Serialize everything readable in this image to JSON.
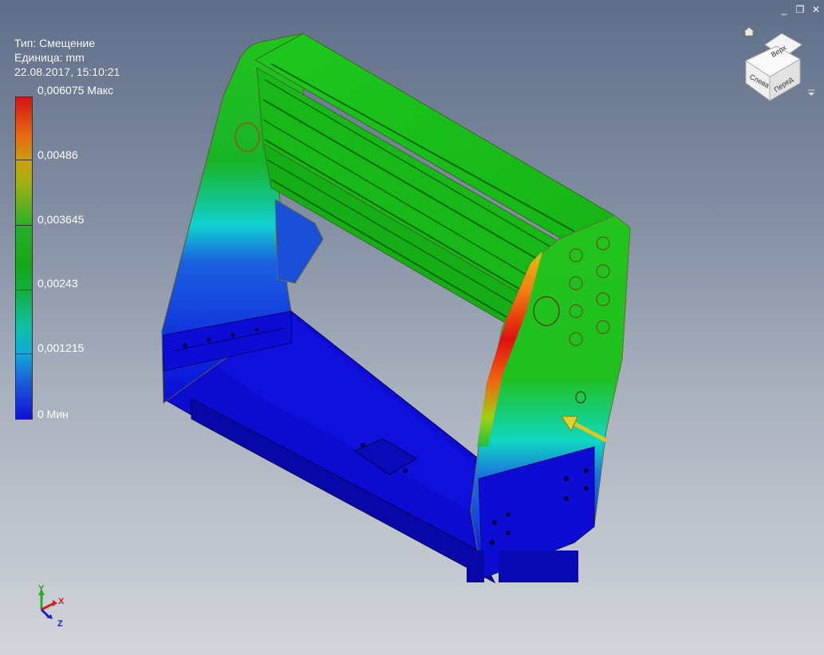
{
  "info": {
    "type_line": "Тип: Смещение",
    "unit_line": "Единица: mm",
    "date_line": "22.08.2017, 15:10:21"
  },
  "legend": {
    "labels": [
      "0,006075 Макс",
      "0,00486",
      "0,003645",
      "0,00243",
      "0,001215",
      "0 Мин"
    ]
  },
  "viewcube": {
    "top_label": "Верх",
    "left_label": "Слева",
    "front_label": "Перед"
  },
  "axes": {
    "x": "X",
    "y": "Y",
    "z": "Z"
  },
  "window_controls": {
    "minimize": "_",
    "restore": "❐",
    "close": "✕"
  },
  "colors": {
    "max": "#d61414",
    "mid": "#16a818",
    "min": "#1010d8"
  }
}
